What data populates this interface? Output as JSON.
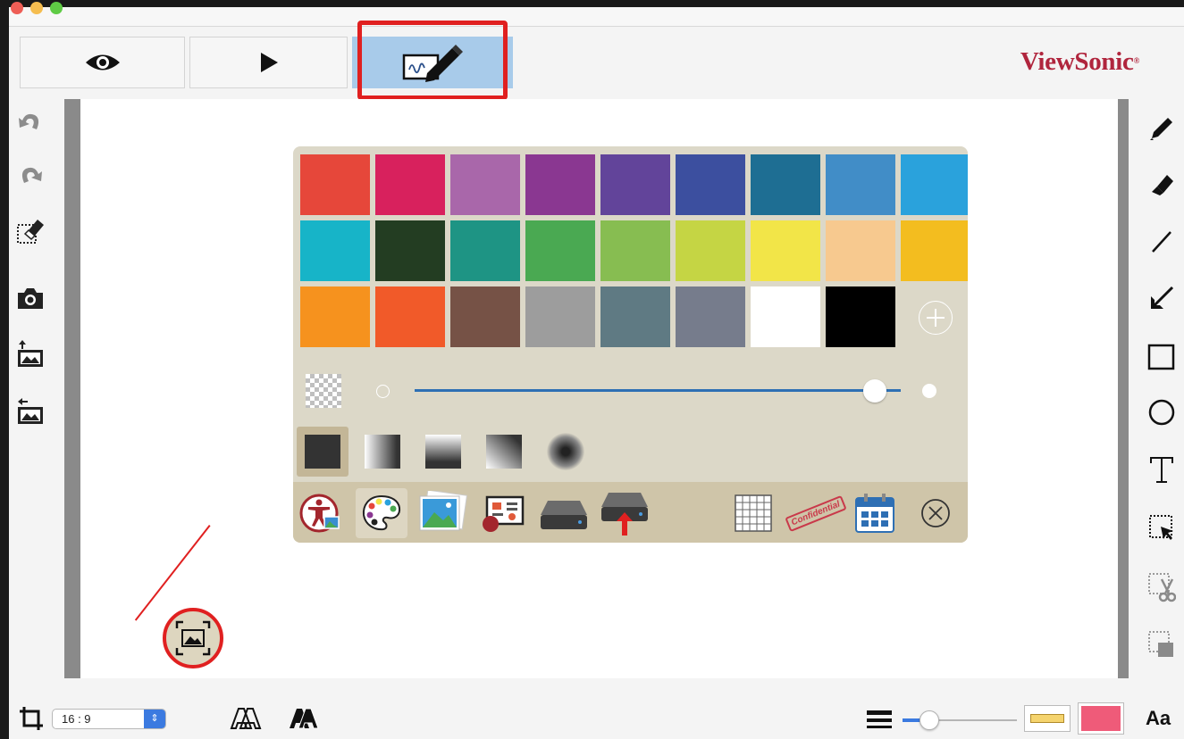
{
  "header": {
    "brand": "ViewSonic",
    "brand_mark": "®",
    "modes": [
      {
        "name": "viewer-mode",
        "icon": "eye-icon"
      },
      {
        "name": "presentation-mode",
        "icon": "play-icon"
      },
      {
        "name": "annotation-mode",
        "icon": "whiteboard-pen-icon",
        "selected": true
      }
    ],
    "highlight_color": "#e02020"
  },
  "left_toolbar": [
    "undo-icon",
    "redo-icon",
    "clear-selection-icon",
    "camera-icon",
    "import-image-icon",
    "export-image-icon"
  ],
  "right_toolbar": [
    "pen-icon",
    "eraser-icon",
    "line-icon",
    "arrow-icon",
    "rectangle-icon",
    "circle-icon",
    "text-icon",
    "select-icon",
    "cut-icon",
    "paste-icon"
  ],
  "palette": {
    "colors": [
      [
        "#e6473a",
        "#d8215d",
        "#a967aa",
        "#8a3791",
        "#62449a",
        "#3c4f9f",
        "#1e6e93",
        "#418dc7",
        "#2aa2dc"
      ],
      [
        "#17b4c8",
        "#233d22",
        "#1e9484",
        "#4aa952",
        "#87bd51",
        "#c5d544",
        "#f2e548",
        "#f7c98f",
        "#f3bd1f"
      ],
      [
        "#f6921e",
        "#f15a29",
        "#765246",
        "#9d9d9d",
        "#5f7a83",
        "#767c8c",
        "#ffffff",
        "#000000"
      ]
    ],
    "opacity_level": 0.97,
    "brush_styles": [
      "solid",
      "gradient-left",
      "gradient-top",
      "gradient-corner",
      "radial"
    ],
    "toolbar": [
      "accessibility-image-icon",
      "palette-icon",
      "gallery-icon",
      "my-content-icon",
      "drive-icon",
      "drive-upload-icon",
      "grid-icon",
      "confidential-stamp-icon",
      "calendar-icon",
      "close-icon"
    ],
    "confidential_label": "Confidential"
  },
  "bottom": {
    "aspect_ratio": "16 : 9",
    "line_width_level": 0.18,
    "fill_color": "#f5d46e",
    "stroke_color": "#ef5b79",
    "font_label": "Aa"
  }
}
